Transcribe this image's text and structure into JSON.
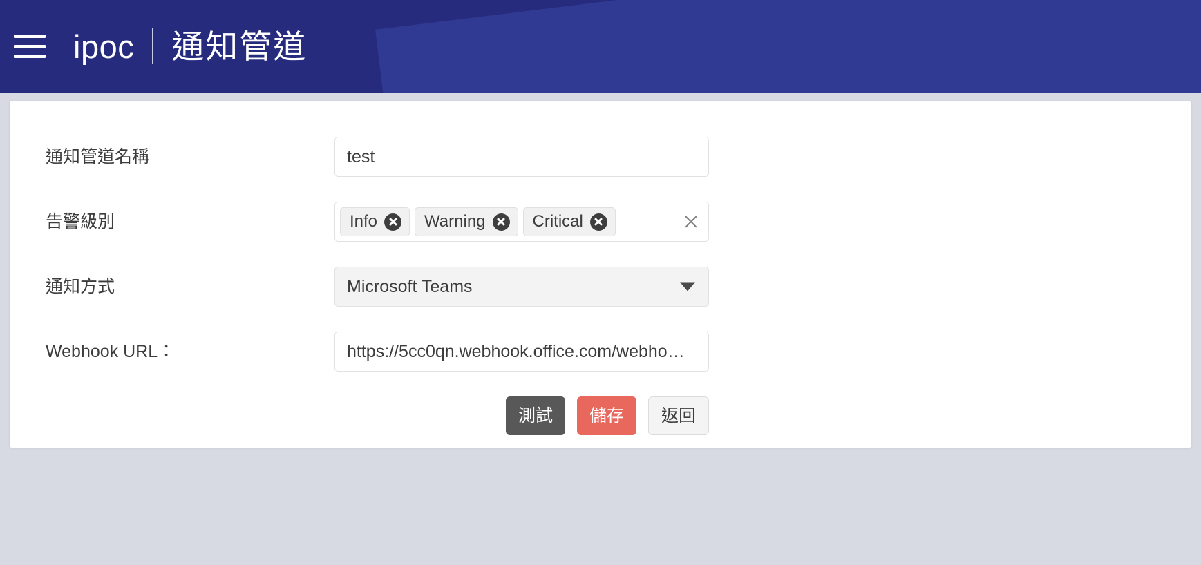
{
  "header": {
    "menu_icon": "hamburger-menu-icon",
    "brand": "ipoc",
    "page_title": "通知管道",
    "background_color": "#262b7e"
  },
  "form": {
    "channel_name": {
      "label": "通知管道名稱",
      "value": "test",
      "placeholder": ""
    },
    "alert_level": {
      "label": "告警級別",
      "tags": [
        "Info",
        "Warning",
        "Critical"
      ],
      "clear_all_icon": "close-icon"
    },
    "notify_method": {
      "label": "通知方式",
      "value": "Microsoft Teams",
      "options": [
        "Microsoft Teams"
      ],
      "caret_icon": "chevron-down-icon"
    },
    "webhook_url": {
      "label": "Webhook URL：",
      "value": "https://5cc0qn.webhook.office.com/webho…",
      "placeholder": ""
    }
  },
  "buttons": {
    "test": "測試",
    "save": "儲存",
    "back": "返回"
  },
  "colors": {
    "header": "#262b7e",
    "save": "#e8685d",
    "test": "#585858",
    "page_background": "#d7d9e3"
  }
}
